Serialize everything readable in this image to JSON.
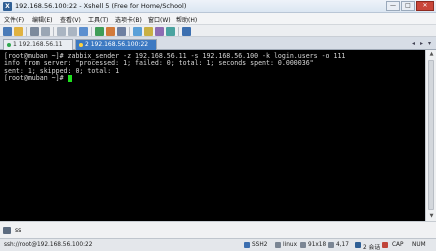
{
  "window": {
    "title": "192.168.56.100:22 - Xshell 5 (Free for Home/School)",
    "controls": [
      "—",
      "□",
      "✕"
    ]
  },
  "menu": [
    "文件(F)",
    "编辑(E)",
    "查看(V)",
    "工具(T)",
    "选项卡(B)",
    "窗口(W)",
    "帮助(H)"
  ],
  "tabs": [
    {
      "label": "1 192.168.56.11",
      "active": false
    },
    {
      "label": "2 192.168.56.100:22",
      "active": true
    }
  ],
  "terminal": {
    "lines": [
      "[root@muban ~]# zabbix_sender -z 192.168.56.11 -s 192.168.56.100 -k login.users -o 111",
      "info from server: \"processed: 1; failed: 0; total: 1; seconds spent: 0.000036\"",
      "sent: 1; skipped: 0; total: 1",
      "[root@muban ~]# "
    ],
    "colors": {
      "background": "#000000",
      "text": "#d8d8d8",
      "cursor": "#1ee01e"
    }
  },
  "send_bar": {
    "text": "ss"
  },
  "status": {
    "connection": "ssh://root@192.168.56.100:22",
    "protocol": "SSH2",
    "terminal_type": "linux",
    "size": "91x18",
    "cursor_pos": "4,17",
    "sessions": "2 会话",
    "cap": "CAP",
    "num": "NUM"
  }
}
